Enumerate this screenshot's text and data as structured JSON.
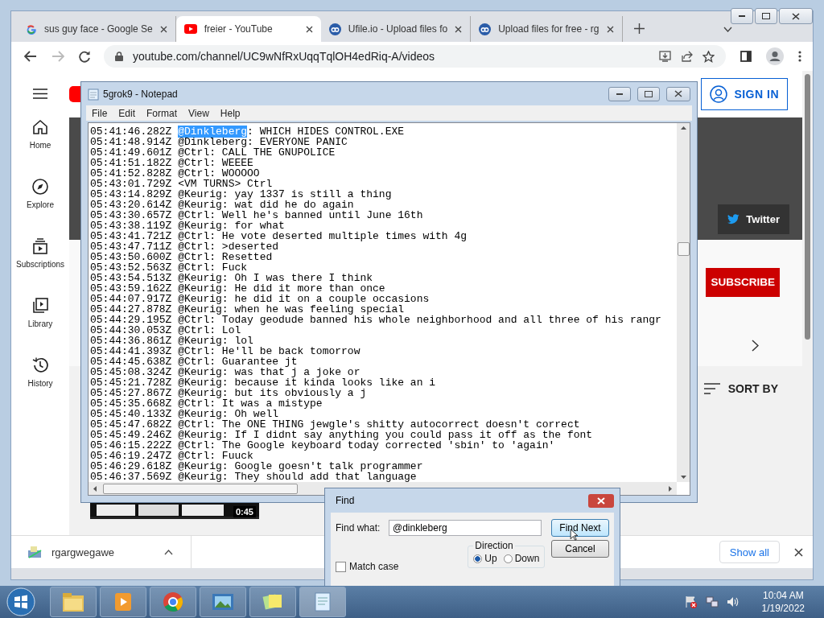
{
  "browser": {
    "tabs": [
      {
        "title": "sus guy face - Google Se",
        "kind": "google",
        "selected": false
      },
      {
        "title": "freier - YouTube",
        "kind": "youtube",
        "selected": true
      },
      {
        "title": "Ufile.io - Upload files fo",
        "kind": "cloud",
        "selected": false
      },
      {
        "title": "Upload files for free - rg",
        "kind": "cloud",
        "selected": false
      }
    ],
    "address": "youtube.com/channel/UC9wNfRxUqqTqlOH4edRiq-A/videos"
  },
  "youtube": {
    "sidebar": [
      {
        "label": "Home",
        "kind": "home"
      },
      {
        "label": "Explore",
        "kind": "explore"
      },
      {
        "label": "Subscriptions",
        "kind": "subscriptions"
      },
      {
        "label": "Library",
        "kind": "library"
      },
      {
        "label": "History",
        "kind": "history"
      }
    ],
    "sign_in": "SIGN IN",
    "twitter": "Twitter",
    "subscribe": "SUBSCRIBE",
    "sort_by": "SORT BY",
    "video_duration": "0:45"
  },
  "notepad": {
    "title": "5grok9 - Notepad",
    "menu": [
      "File",
      "Edit",
      "Format",
      "View",
      "Help"
    ],
    "lines": [
      [
        {
          "text": "05:41:46.282Z ",
          "selected": false
        },
        {
          "text": "@Dinkleberg",
          "selected": true
        },
        {
          "text": ": WHICH HIDES CONTROL.EXE",
          "selected": false
        }
      ],
      [
        {
          "text": "05:41:48.914Z @Dinkleberg: EVERYONE PANIC",
          "selected": false
        }
      ],
      [
        {
          "text": "05:41:49.601Z @Ctrl: CALL THE GNUPOLICE",
          "selected": false
        }
      ],
      [
        {
          "text": "05:41:51.182Z @Ctrl: WEEEE",
          "selected": false
        }
      ],
      [
        {
          "text": "05:41:52.828Z @Ctrl: WOOOOO",
          "selected": false
        }
      ],
      [
        {
          "text": "05:43:01.729Z <VM TURNS> Ctrl",
          "selected": false
        }
      ],
      [
        {
          "text": "05:43:14.829Z @Keurig: yay 1337 is still a thing",
          "selected": false
        }
      ],
      [
        {
          "text": "05:43:20.614Z @Keurig: wat did he do again",
          "selected": false
        }
      ],
      [
        {
          "text": "05:43:30.657Z @Ctrl: Well he's banned until June 16th",
          "selected": false
        }
      ],
      [
        {
          "text": "05:43:38.119Z @Keurig: for what",
          "selected": false
        }
      ],
      [
        {
          "text": "05:43:41.721Z @Ctrl: He vote deserted multiple times with 4g",
          "selected": false
        }
      ],
      [
        {
          "text": "05:43:47.711Z @Ctrl: >deserted",
          "selected": false
        }
      ],
      [
        {
          "text": "05:43:50.600Z @Ctrl: Resetted",
          "selected": false
        }
      ],
      [
        {
          "text": "05:43:52.563Z @Ctrl: Fuck",
          "selected": false
        }
      ],
      [
        {
          "text": "05:43:54.513Z @Keurig: Oh I was there I think",
          "selected": false
        }
      ],
      [
        {
          "text": "05:43:59.162Z @Keurig: He did it more than once",
          "selected": false
        }
      ],
      [
        {
          "text": "05:44:07.917Z @Keurig: he did it on a couple occasions",
          "selected": false
        }
      ],
      [
        {
          "text": "05:44:27.878Z @Keurig: when he was feeling special",
          "selected": false
        }
      ],
      [
        {
          "text": "05:44:29.195Z @Ctrl: Today geodude banned his whole neighborhood and all three of his rangr",
          "selected": false
        }
      ],
      [
        {
          "text": "05:44:30.053Z @Ctrl: Lol",
          "selected": false
        }
      ],
      [
        {
          "text": "05:44:36.861Z @Keurig: lol",
          "selected": false
        }
      ],
      [
        {
          "text": "05:44:41.393Z @Ctrl: He'll be back tomorrow",
          "selected": false
        }
      ],
      [
        {
          "text": "05:44:45.638Z @Ctrl: Guarantee jt",
          "selected": false
        }
      ],
      [
        {
          "text": "05:45:08.324Z @Keurig: was that j a joke or",
          "selected": false
        }
      ],
      [
        {
          "text": "05:45:21.728Z @Keurig: because it kinda looks like an i",
          "selected": false
        }
      ],
      [
        {
          "text": "05:45:27.867Z @Keurig: but its obviously a j",
          "selected": false
        }
      ],
      [
        {
          "text": "05:45:35.668Z @Ctrl: It was a mistype",
          "selected": false
        }
      ],
      [
        {
          "text": "05:45:40.133Z @Keurig: Oh well",
          "selected": false
        }
      ],
      [
        {
          "text": "05:45:47.682Z @Ctrl: The ONE THING jewgle's shitty autocorrect doesn't correct",
          "selected": false
        }
      ],
      [
        {
          "text": "05:45:49.246Z @Keurig: If I didnt say anything you could pass it off as the font",
          "selected": false
        }
      ],
      [
        {
          "text": "05:46:15.222Z @Ctrl: The Google keyboard today corrected 'sbin' to 'again'",
          "selected": false
        }
      ],
      [
        {
          "text": "05:46:19.247Z @Ctrl: Fuuck",
          "selected": false
        }
      ],
      [
        {
          "text": "05:46:29.618Z @Keurig: Google goesn't talk programmer",
          "selected": false
        }
      ],
      [
        {
          "text": "05:46:37.569Z @Keurig: They should add that language",
          "selected": false
        }
      ]
    ]
  },
  "find": {
    "title": "Find",
    "label": "Find what:",
    "value": "@dinkleberg",
    "find_next": "Find Next",
    "cancel": "Cancel",
    "match_case": {
      "label": "Match case",
      "checked": false
    },
    "direction": {
      "label": "Direction",
      "options": [
        {
          "label": "Up",
          "selected": true
        },
        {
          "label": "Down",
          "selected": false
        }
      ]
    }
  },
  "downloads": {
    "file": "rgargwegawe",
    "show_all": "Show all"
  },
  "taskbar": {
    "apps": [
      {
        "kind": "folder"
      },
      {
        "kind": "media"
      },
      {
        "kind": "browser"
      },
      {
        "kind": "photos"
      },
      {
        "kind": "notes"
      },
      {
        "kind": "notepad"
      }
    ],
    "time": "10:04 AM",
    "date": "1/19/2022"
  }
}
